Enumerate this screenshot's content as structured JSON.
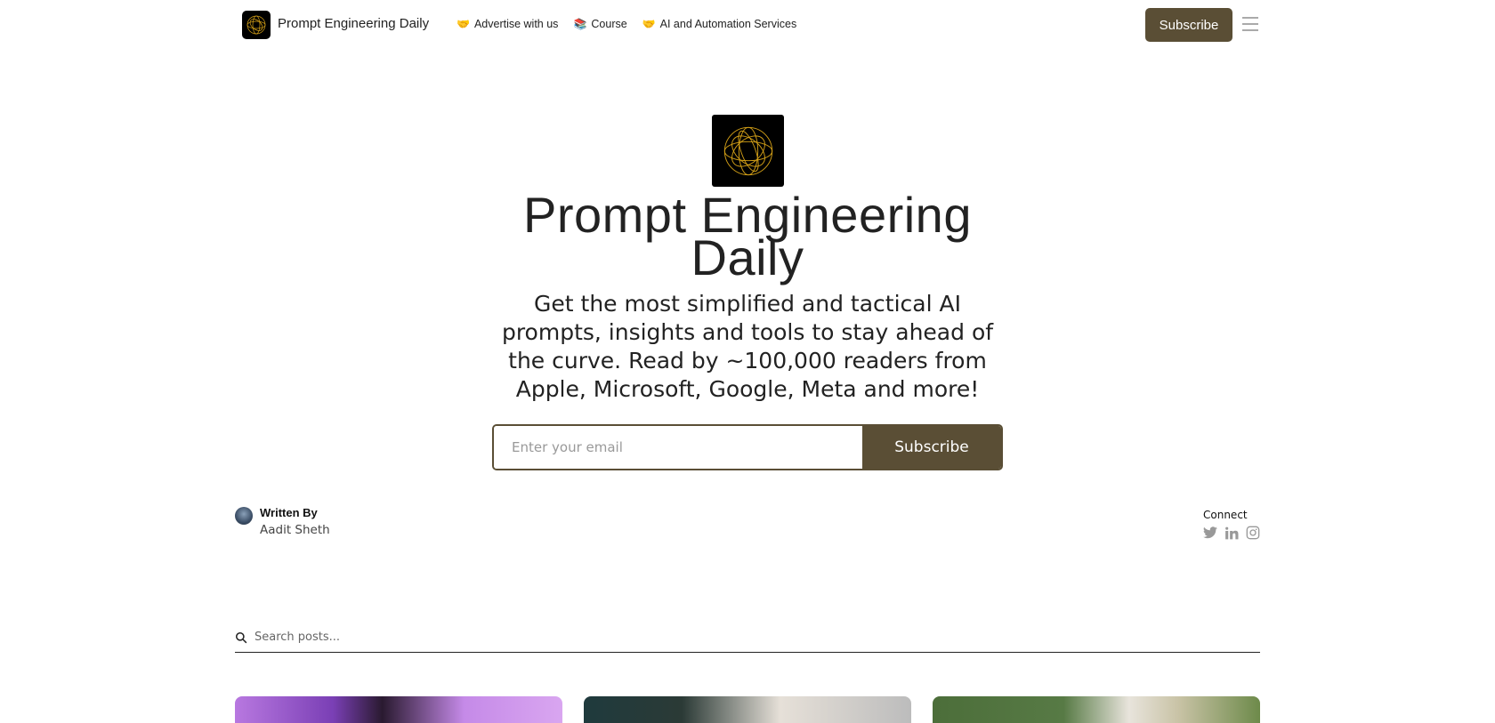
{
  "nav": {
    "brand": "Prompt Engineering Daily",
    "links": [
      {
        "icon": "handshake-icon",
        "glyph": "🤝",
        "label": "Advertise with us"
      },
      {
        "icon": "books-icon",
        "glyph": "📚",
        "label": "Course"
      },
      {
        "icon": "handshake-icon",
        "glyph": "🤝",
        "label": "AI and Automation Services"
      }
    ],
    "subscribe_label": "Subscribe"
  },
  "hero": {
    "title": "Prompt Engineering Daily",
    "description": "Get the most simplified and tactical AI prompts, insights and tools to stay ahead of the curve. Read by ~100,000 readers from Apple, Microsoft, Google, Meta and more!",
    "email_placeholder": "Enter your email",
    "subscribe_label": "Subscribe"
  },
  "author": {
    "label": "Written By",
    "name": "Aadit Sheth"
  },
  "connect": {
    "label": "Connect",
    "socials": [
      "twitter-icon",
      "linkedin-icon",
      "instagram-icon"
    ]
  },
  "search": {
    "placeholder": "Search posts..."
  },
  "colors": {
    "accent": "#5a4e35",
    "logo_gold": "#d4a017"
  }
}
